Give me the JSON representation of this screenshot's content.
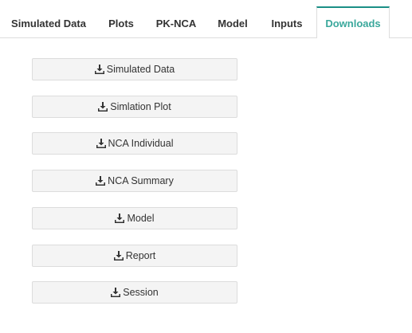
{
  "tabs": [
    {
      "label": "Simulated Data",
      "active": false
    },
    {
      "label": "Plots",
      "active": false
    },
    {
      "label": "PK-NCA",
      "active": false
    },
    {
      "label": "Model",
      "active": false
    },
    {
      "label": "Inputs",
      "active": false
    },
    {
      "label": "Downloads",
      "active": true
    }
  ],
  "downloads": {
    "icon": "download-icon",
    "buttons": [
      {
        "label": "Simulated Data"
      },
      {
        "label": "Simlation Plot"
      },
      {
        "label": "NCA Individual"
      },
      {
        "label": "NCA Summary"
      },
      {
        "label": "Model"
      },
      {
        "label": "Report"
      },
      {
        "label": "Session"
      }
    ]
  },
  "colors": {
    "active_tab_text": "#3aa89c",
    "active_tab_border": "#1a8f86",
    "button_bg": "#f4f4f4",
    "button_border": "#dcdcdc"
  }
}
